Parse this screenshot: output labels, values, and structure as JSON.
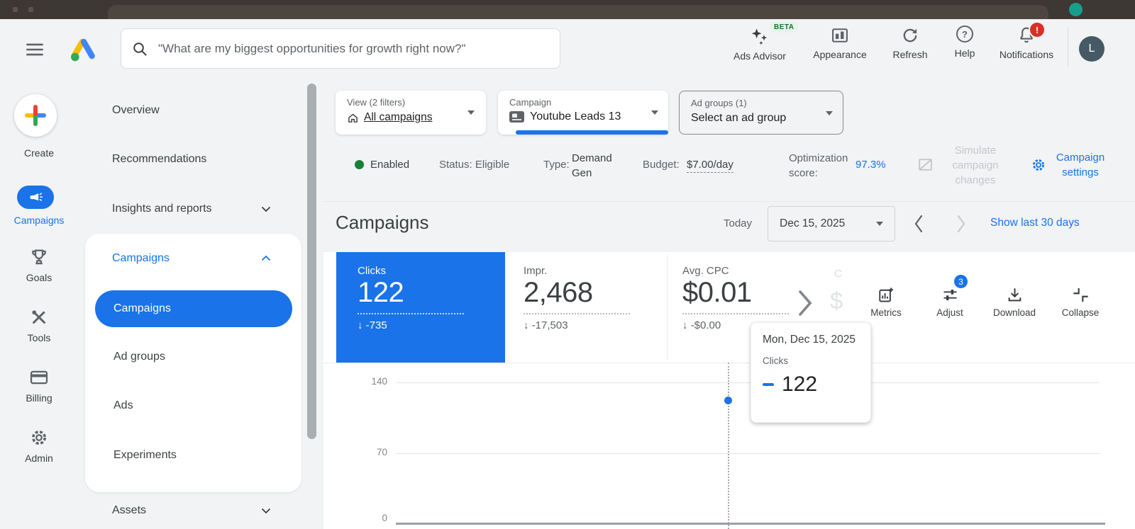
{
  "header": {
    "search_placeholder": "\"What are my biggest opportunities for growth right now?\"",
    "ads_advisor": "Ads Advisor",
    "beta_badge": "BETA",
    "appearance": "Appearance",
    "refresh": "Refresh",
    "help": "Help",
    "help_glyph": "?",
    "notifications": "Notifications",
    "notification_badge": "!",
    "avatar_initial": "L"
  },
  "rail": {
    "create": "Create",
    "campaigns": "Campaigns",
    "goals": "Goals",
    "tools": "Tools",
    "billing": "Billing",
    "admin": "Admin"
  },
  "subnav": {
    "overview": "Overview",
    "recommendations": "Recommendations",
    "insights": "Insights and reports",
    "campaigns_header": "Campaigns",
    "campaigns_item": "Campaigns",
    "ad_groups": "Ad groups",
    "ads": "Ads",
    "experiments": "Experiments",
    "assets": "Assets"
  },
  "filters": {
    "view_label": "View (2 filters)",
    "view_value": "All campaigns",
    "campaign_label": "Campaign",
    "campaign_value": "Youtube Leads 13",
    "adgroup_label": "Ad groups (1)",
    "adgroup_value": "Select an ad group"
  },
  "status": {
    "enabled": "Enabled",
    "status_text": "Status: Eligible",
    "type_label": "Type:",
    "type_value": "Demand Gen",
    "budget_label": "Budget:",
    "budget_value": "$7.00/day",
    "optimization_label": "Optimization score:",
    "optimization_value": "97.3%",
    "simulate": "Simulate campaign changes",
    "campaign_settings": "Campaign settings"
  },
  "toolbar": {
    "title": "Campaigns",
    "today_label": "Today",
    "date_value": "Dec 15, 2025",
    "show_last_30": "Show last 30 days"
  },
  "metrics": {
    "down_arrow": "↓",
    "cards": [
      {
        "label": "Clicks",
        "value": "122",
        "delta": "-735"
      },
      {
        "label": "Impr.",
        "value": "2,468",
        "delta": "-17,503"
      },
      {
        "label": "Avg. CPC",
        "value": "$0.01",
        "delta": "-$0.00"
      }
    ],
    "hidden_next_label": "C",
    "hidden_next_value": "$",
    "actions": {
      "metrics": "Metrics",
      "adjust": "Adjust",
      "adjust_badge": "3",
      "download": "Download",
      "collapse": "Collapse"
    }
  },
  "tooltip": {
    "date": "Mon, Dec 15, 2025",
    "series": "Clicks",
    "value": "122"
  },
  "chart_data": {
    "type": "line",
    "x": [
      "Mon, Dec 15, 2025"
    ],
    "series": [
      {
        "name": "Clicks",
        "values": [
          122
        ]
      }
    ],
    "yticks": [
      "0",
      "70",
      "140"
    ],
    "ylim": [
      0,
      150
    ],
    "grid": true,
    "legend": "none",
    "hover_point": {
      "x": "Mon, Dec 15, 2025",
      "clicks": 122
    }
  },
  "colors": {
    "accent_blue": "#1a73e8",
    "enabled_green": "#188038",
    "alert_red": "#d93025"
  }
}
